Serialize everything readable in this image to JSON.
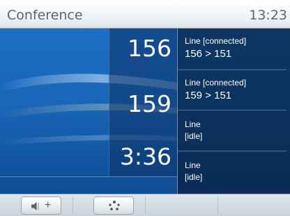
{
  "header": {
    "title": "Conference",
    "time": "13:23"
  },
  "participants": {
    "first_number": "156",
    "second_number": "159",
    "duration": "3:36"
  },
  "lines": [
    {
      "title": "Line [connected]",
      "detail": "156 > 151"
    },
    {
      "title": "Line [connected]",
      "detail": "159 > 151"
    },
    {
      "title": "Line\n[idle]"
    },
    {
      "title": "Line\n[idle]"
    }
  ],
  "softkeys": {
    "volume_plus_label": "+",
    "volume_icon": "speaker-icon",
    "dots_icon": "conference-dots-icon"
  },
  "colors": {
    "screen_blue": "#1a66b8",
    "panel_navy": "#0e3766",
    "title_text": "#5b6670"
  }
}
